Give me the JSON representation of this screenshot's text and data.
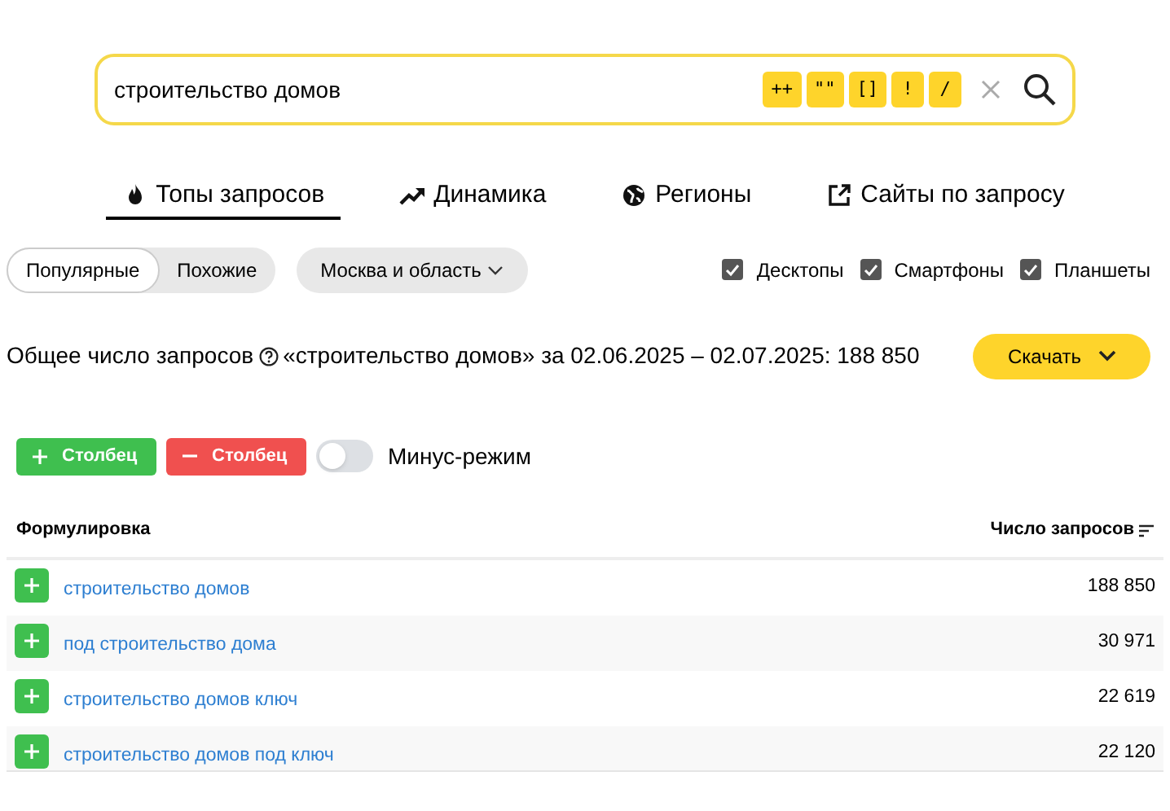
{
  "search": {
    "value": "строительство домов",
    "operators": [
      "++",
      "\"\"",
      "[]",
      "!",
      "/"
    ]
  },
  "tabs": [
    {
      "label": "Топы запросов",
      "kind": "fire",
      "selected": true
    },
    {
      "label": "Динамика",
      "kind": "trend",
      "selected": false
    },
    {
      "label": "Регионы",
      "kind": "globe",
      "selected": false
    },
    {
      "label": "Сайты по запросу",
      "kind": "external",
      "selected": false
    }
  ],
  "modes": [
    {
      "label": "Популярные",
      "selected": true
    },
    {
      "label": "Похожие",
      "selected": false
    }
  ],
  "region": "Москва и область",
  "devices": [
    {
      "label": "Десктопы",
      "checked": true
    },
    {
      "label": "Смартфоны",
      "checked": true
    },
    {
      "label": "Планшеты",
      "checked": true
    }
  ],
  "summary": {
    "label": "Общее число запросов",
    "text": "«строительство домов» за 02.06.2025 – 02.07.2025: 188 850"
  },
  "download_button": "Скачать",
  "column_buttons": [
    {
      "kind": "add",
      "label": "Столбец"
    },
    {
      "kind": "remove",
      "label": "Столбец"
    }
  ],
  "minus_mode": {
    "label": "Минус-режим",
    "on": false
  },
  "table": {
    "columns": [
      "Формулировка",
      "Число запросов"
    ],
    "rows": [
      {
        "phrase": "строительство домов",
        "count": "188 850"
      },
      {
        "phrase": "под строительство дома",
        "count": "30 971"
      },
      {
        "phrase": "строительство домов ключ",
        "count": "22 619"
      },
      {
        "phrase": "строительство домов под ключ",
        "count": "22 120"
      }
    ]
  }
}
